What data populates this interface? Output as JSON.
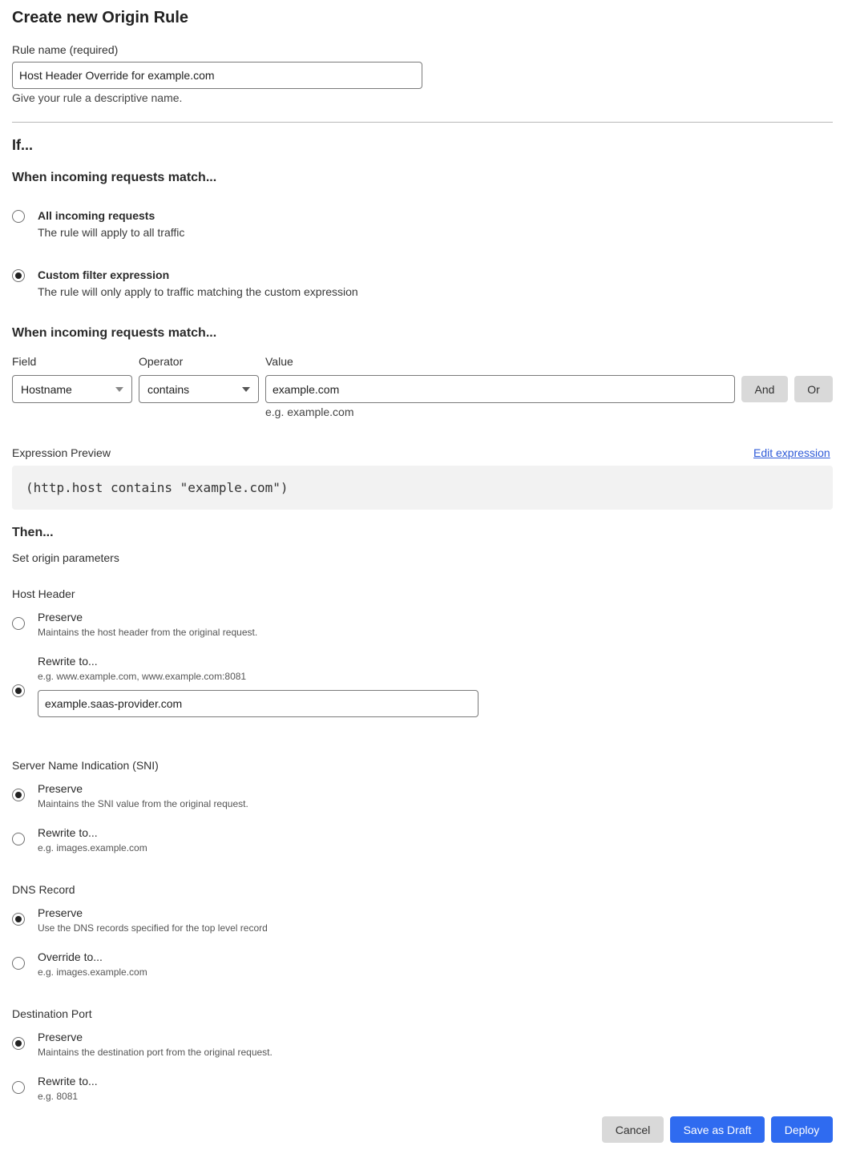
{
  "page": {
    "title": "Create new Origin Rule"
  },
  "rule_name": {
    "label": "Rule name (required)",
    "value": "Host Header Override for example.com",
    "help": "Give your rule a descriptive name."
  },
  "if_section": {
    "heading": "If...",
    "match_heading": "When incoming requests match...",
    "options": [
      {
        "title": "All incoming requests",
        "description": "The rule will apply to all traffic",
        "selected": false
      },
      {
        "title": "Custom filter expression",
        "description": "The rule will only apply to traffic matching the custom expression",
        "selected": true
      }
    ]
  },
  "expression_builder": {
    "heading": "When incoming requests match...",
    "field_label": "Field",
    "field_value": "Hostname",
    "operator_label": "Operator",
    "operator_value": "contains",
    "value_label": "Value",
    "value_value": "example.com",
    "value_help": "e.g. example.com",
    "and_label": "And",
    "or_label": "Or"
  },
  "expression_preview": {
    "label": "Expression Preview",
    "edit_link": "Edit expression",
    "code": "(http.host contains \"example.com\")"
  },
  "then_section": {
    "heading": "Then...",
    "subheading": "Set origin parameters"
  },
  "host_header": {
    "label": "Host Header",
    "options": [
      {
        "title": "Preserve",
        "description": "Maintains the host header from the original request.",
        "selected": false
      },
      {
        "title": "Rewrite to...",
        "description": "e.g. www.example.com, www.example.com:8081",
        "selected": true,
        "value": "example.saas-provider.com"
      }
    ]
  },
  "sni": {
    "label": "Server Name Indication (SNI)",
    "options": [
      {
        "title": "Preserve",
        "description": "Maintains the SNI value from the original request.",
        "selected": true
      },
      {
        "title": "Rewrite to...",
        "description": "e.g. images.example.com",
        "selected": false
      }
    ]
  },
  "dns_record": {
    "label": "DNS Record",
    "options": [
      {
        "title": "Preserve",
        "description": "Use the DNS records specified for the top level record",
        "selected": true
      },
      {
        "title": "Override to...",
        "description": "e.g. images.example.com",
        "selected": false
      }
    ]
  },
  "destination_port": {
    "label": "Destination Port",
    "options": [
      {
        "title": "Preserve",
        "description": "Maintains the destination port from the original request.",
        "selected": true
      },
      {
        "title": "Rewrite to...",
        "description": "e.g. 8081",
        "selected": false
      }
    ]
  },
  "footer": {
    "cancel_label": "Cancel",
    "save_draft_label": "Save as Draft",
    "deploy_label": "Deploy"
  },
  "colors": {
    "primary": "#2f6bf0",
    "secondary_button": "#d9d9d9",
    "link": "#2f5bd8",
    "code_background": "#f2f2f2"
  }
}
